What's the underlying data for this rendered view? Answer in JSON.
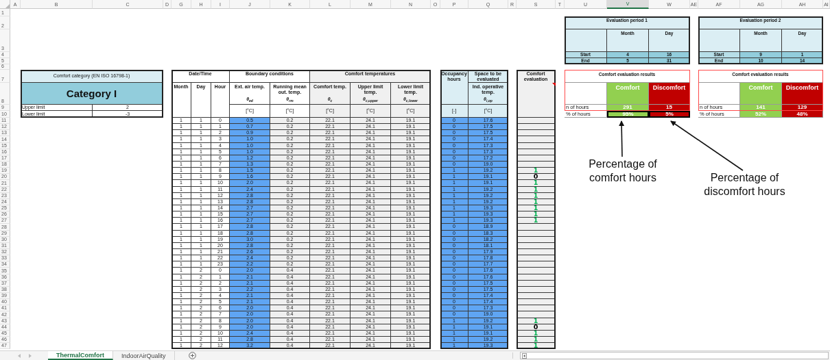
{
  "column_headers": [
    {
      "label": "A",
      "selected": false
    },
    {
      "label": "B",
      "selected": false
    },
    {
      "label": "C",
      "selected": false
    },
    {
      "label": "D",
      "selected": false
    },
    {
      "label": "G",
      "selected": false
    },
    {
      "label": "H",
      "selected": false
    },
    {
      "label": "I",
      "selected": false
    },
    {
      "label": "J",
      "selected": false
    },
    {
      "label": "K",
      "selected": false
    },
    {
      "label": "L",
      "selected": false
    },
    {
      "label": "M",
      "selected": false
    },
    {
      "label": "N",
      "selected": false
    },
    {
      "label": "O",
      "selected": false
    },
    {
      "label": "P",
      "selected": false
    },
    {
      "label": "Q",
      "selected": false
    },
    {
      "label": "R",
      "selected": false
    },
    {
      "label": "S",
      "selected": false
    },
    {
      "label": "T",
      "selected": false
    },
    {
      "label": "U",
      "selected": false
    },
    {
      "label": "V",
      "selected": true
    },
    {
      "label": "W",
      "selected": false
    },
    {
      "label": "AE",
      "selected": false
    },
    {
      "label": "AF",
      "selected": false
    },
    {
      "label": "AG",
      "selected": false
    },
    {
      "label": "AH",
      "selected": false
    },
    {
      "label": "AI",
      "selected": false
    }
  ],
  "row_headers": [
    "1",
    "2",
    "3",
    "4",
    "5",
    "6",
    "7",
    "8",
    "9",
    "10",
    "11",
    "12",
    "13",
    "14",
    "15",
    "16",
    "17",
    "18",
    "19",
    "20",
    "21",
    "22",
    "23",
    "24",
    "25",
    "26",
    "27",
    "28",
    "29",
    "30",
    "31",
    "32",
    "33",
    "34",
    "35",
    "36",
    "37",
    "38",
    "39",
    "40",
    "41",
    "42",
    "43",
    "44",
    "45",
    "46",
    "47"
  ],
  "comfort_category": {
    "title": "Comfort category (EN ISO 16798-1)",
    "category": "Category I",
    "limits": [
      {
        "label": "Upper limit",
        "value": "2"
      },
      {
        "label": "Lower limit",
        "value": "-3"
      }
    ]
  },
  "main_table": {
    "groups": [
      {
        "label": "Date/Time",
        "columns": [
          {
            "label": "Month"
          },
          {
            "label": "Day"
          },
          {
            "label": "Hour"
          }
        ]
      },
      {
        "label": "Boundary conditions",
        "columns": [
          {
            "label": "Ext. air temp.",
            "symbol": "θ$_{ed}$",
            "unit": "[°C]"
          },
          {
            "label": "Running mean out. temp.",
            "symbol": "θ$_{rm}$",
            "unit": "[°C]"
          }
        ]
      },
      {
        "label": "Comfort temperatures",
        "columns": [
          {
            "label": "Comfort temp.",
            "symbol": "θ$_{c}$",
            "unit": "[°C]"
          },
          {
            "label": "Upper limit temp.",
            "symbol": "θ$_{c,upper}$",
            "unit": "[°C]"
          },
          {
            "label": "Lower limit temp.",
            "symbol": "θ$_{c,lower}$",
            "unit": "[°C]"
          }
        ]
      }
    ]
  },
  "occupancy_table": {
    "columns": [
      {
        "label": "Occupancy hours",
        "unit": "[-]"
      },
      {
        "group": "Space to be evaluated",
        "label": "Ind. operative temp.",
        "symbol": "θ$_{i,op}$",
        "unit": "[°C]"
      }
    ]
  },
  "evaluation_column": {
    "label": "Comfort evaluation"
  },
  "rows": [
    {
      "cells": [
        "1",
        "1",
        "0",
        "0.5",
        "0.2",
        "22.1",
        "24.1",
        "19.1",
        "0",
        "17.6"
      ]
    },
    {
      "cells": [
        "1",
        "1",
        "1",
        "0.7",
        "0.2",
        "22.1",
        "24.1",
        "19.1",
        "0",
        "17.5"
      ]
    },
    {
      "cells": [
        "1",
        "1",
        "2",
        "0.9",
        "0.2",
        "22.1",
        "24.1",
        "19.1",
        "0",
        "17.5"
      ]
    },
    {
      "cells": [
        "1",
        "1",
        "3",
        "1.0",
        "0.2",
        "22.1",
        "24.1",
        "19.1",
        "0",
        "17.4"
      ]
    },
    {
      "cells": [
        "1",
        "1",
        "4",
        "1.0",
        "0.2",
        "22.1",
        "24.1",
        "19.1",
        "0",
        "17.3"
      ]
    },
    {
      "cells": [
        "1",
        "1",
        "5",
        "1.0",
        "0.2",
        "22.1",
        "24.1",
        "19.1",
        "0",
        "17.3"
      ]
    },
    {
      "cells": [
        "1",
        "1",
        "6",
        "1.2",
        "0.2",
        "22.1",
        "24.1",
        "19.1",
        "0",
        "17.2"
      ]
    },
    {
      "cells": [
        "1",
        "1",
        "7",
        "1.3",
        "0.2",
        "22.1",
        "24.1",
        "19.1",
        "0",
        "19.0"
      ]
    },
    {
      "cells": [
        "1",
        "1",
        "8",
        "1.5",
        "0.2",
        "22.1",
        "24.1",
        "19.1",
        "1",
        "19.2"
      ],
      "evaluation": {
        "text": "1",
        "color": "#00b050"
      }
    },
    {
      "cells": [
        "1",
        "1",
        "9",
        "1.6",
        "0.2",
        "22.1",
        "24.1",
        "19.1",
        "1",
        "19.1"
      ],
      "evaluation": {
        "text": "0",
        "color": "#000000"
      }
    },
    {
      "cells": [
        "1",
        "1",
        "10",
        "2.0",
        "0.2",
        "22.1",
        "24.1",
        "19.1",
        "1",
        "19.1"
      ],
      "evaluation": {
        "text": "1",
        "color": "#00b050"
      }
    },
    {
      "cells": [
        "1",
        "1",
        "11",
        "2.4",
        "0.2",
        "22.1",
        "24.1",
        "19.1",
        "1",
        "19.2"
      ],
      "evaluation": {
        "text": "1",
        "color": "#00b050"
      }
    },
    {
      "cells": [
        "1",
        "1",
        "12",
        "2.8",
        "0.2",
        "22.1",
        "24.1",
        "19.1",
        "1",
        "19.2"
      ],
      "evaluation": {
        "text": "1",
        "color": "#00b050"
      }
    },
    {
      "cells": [
        "1",
        "1",
        "13",
        "2.8",
        "0.2",
        "22.1",
        "24.1",
        "19.1",
        "1",
        "19.2"
      ],
      "evaluation": {
        "text": "1",
        "color": "#00b050"
      }
    },
    {
      "cells": [
        "1",
        "1",
        "14",
        "2.7",
        "0.2",
        "22.1",
        "24.1",
        "19.1",
        "1",
        "19.3"
      ],
      "evaluation": {
        "text": "1",
        "color": "#00b050"
      }
    },
    {
      "cells": [
        "1",
        "1",
        "15",
        "2.7",
        "0.2",
        "22.1",
        "24.1",
        "19.1",
        "1",
        "19.3"
      ],
      "evaluation": {
        "text": "1",
        "color": "#00b050"
      }
    },
    {
      "cells": [
        "1",
        "1",
        "16",
        "2.7",
        "0.2",
        "22.1",
        "24.1",
        "19.1",
        "1",
        "19.3"
      ],
      "evaluation": {
        "text": "1",
        "color": "#00b050"
      }
    },
    {
      "cells": [
        "1",
        "1",
        "17",
        "2.8",
        "0.2",
        "22.1",
        "24.1",
        "19.1",
        "0",
        "18.9"
      ]
    },
    {
      "cells": [
        "1",
        "1",
        "18",
        "2.8",
        "0.2",
        "22.1",
        "24.1",
        "19.1",
        "0",
        "18.3"
      ]
    },
    {
      "cells": [
        "1",
        "1",
        "19",
        "3.0",
        "0.2",
        "22.1",
        "24.1",
        "19.1",
        "0",
        "18.2"
      ]
    },
    {
      "cells": [
        "1",
        "1",
        "20",
        "2.8",
        "0.2",
        "22.1",
        "24.1",
        "19.1",
        "0",
        "18.1"
      ]
    },
    {
      "cells": [
        "1",
        "1",
        "21",
        "2.6",
        "0.2",
        "22.1",
        "24.1",
        "19.1",
        "0",
        "17.9"
      ]
    },
    {
      "cells": [
        "1",
        "1",
        "22",
        "2.4",
        "0.2",
        "22.1",
        "24.1",
        "19.1",
        "0",
        "17.8"
      ]
    },
    {
      "cells": [
        "1",
        "1",
        "23",
        "2.2",
        "0.2",
        "22.1",
        "24.1",
        "19.1",
        "0",
        "17.7"
      ]
    },
    {
      "cells": [
        "1",
        "2",
        "0",
        "2.0",
        "0.4",
        "22.1",
        "24.1",
        "19.1",
        "0",
        "17.6"
      ]
    },
    {
      "cells": [
        "1",
        "2",
        "1",
        "2.1",
        "0.4",
        "22.1",
        "24.1",
        "19.1",
        "0",
        "17.6"
      ]
    },
    {
      "cells": [
        "1",
        "2",
        "2",
        "2.1",
        "0.4",
        "22.1",
        "24.1",
        "19.1",
        "0",
        "17.5"
      ]
    },
    {
      "cells": [
        "1",
        "2",
        "3",
        "2.2",
        "0.4",
        "22.1",
        "24.1",
        "19.1",
        "0",
        "17.5"
      ]
    },
    {
      "cells": [
        "1",
        "2",
        "4",
        "2.1",
        "0.4",
        "22.1",
        "24.1",
        "19.1",
        "0",
        "17.4"
      ]
    },
    {
      "cells": [
        "1",
        "2",
        "5",
        "2.1",
        "0.4",
        "22.1",
        "24.1",
        "19.1",
        "0",
        "17.4"
      ]
    },
    {
      "cells": [
        "1",
        "2",
        "6",
        "2.0",
        "0.4",
        "22.1",
        "24.1",
        "19.1",
        "0",
        "17.3"
      ]
    },
    {
      "cells": [
        "1",
        "2",
        "7",
        "2.0",
        "0.4",
        "22.1",
        "24.1",
        "19.1",
        "0",
        "19.0"
      ]
    },
    {
      "cells": [
        "1",
        "2",
        "8",
        "2.0",
        "0.4",
        "22.1",
        "24.1",
        "19.1",
        "1",
        "19.2"
      ],
      "evaluation": {
        "text": "1",
        "color": "#00b050"
      }
    },
    {
      "cells": [
        "1",
        "2",
        "9",
        "2.0",
        "0.4",
        "22.1",
        "24.1",
        "19.1",
        "1",
        "19.1"
      ],
      "evaluation": {
        "text": "0",
        "color": "#000000"
      }
    },
    {
      "cells": [
        "1",
        "2",
        "10",
        "2.4",
        "0.4",
        "22.1",
        "24.1",
        "19.1",
        "1",
        "19.1"
      ],
      "evaluation": {
        "text": "1",
        "color": "#00b050"
      }
    },
    {
      "cells": [
        "1",
        "2",
        "11",
        "2.8",
        "0.4",
        "22.1",
        "24.1",
        "19.1",
        "1",
        "19.2"
      ],
      "evaluation": {
        "text": "1",
        "color": "#00b050"
      }
    },
    {
      "cells": [
        "1",
        "2",
        "12",
        "3.2",
        "0.4",
        "22.1",
        "24.1",
        "19.1",
        "1",
        "19.3"
      ],
      "evaluation": {
        "text": "1",
        "color": "#00b050"
      }
    }
  ],
  "evaluation_periods": [
    {
      "title": "Evaluation period 1",
      "headers": [
        "Month",
        "Day"
      ],
      "rows": [
        {
          "label": "Start",
          "values": [
            "4",
            "16"
          ]
        },
        {
          "label": "End",
          "values": [
            "5",
            "31"
          ]
        }
      ],
      "results": {
        "title": "Comfort evaluation results",
        "headers": [
          {
            "label": "Comfort",
            "color": "#92d050"
          },
          {
            "label": "Discomfort",
            "color": "#c00000"
          }
        ],
        "rows": [
          {
            "label": "n of hours",
            "values": [
              "291",
              "15"
            ],
            "outlined": false
          },
          {
            "label": "% of hours",
            "values": [
              "95%",
              "5%"
            ],
            "outlined": true
          }
        ]
      }
    },
    {
      "title": "Evaluation period 2",
      "headers": [
        "Month",
        "Day"
      ],
      "rows": [
        {
          "label": "Start",
          "values": [
            "9",
            "1"
          ]
        },
        {
          "label": "End",
          "values": [
            "10",
            "14"
          ]
        }
      ],
      "results": {
        "title": "Comfort evaluation results",
        "headers": [
          {
            "label": "Comfort",
            "color": "#92d050"
          },
          {
            "label": "Discomfort",
            "color": "#c00000"
          }
        ],
        "rows": [
          {
            "label": "n of hours",
            "values": [
              "141",
              "129"
            ],
            "outlined": false
          },
          {
            "label": "% of hours",
            "values": [
              "52%",
              "48%"
            ],
            "outlined": false
          }
        ]
      }
    }
  ],
  "annotations": [
    {
      "text": "Percentage of comfort hours"
    },
    {
      "text": "Percentage of discomfort hours"
    }
  ],
  "sheet_tabs": [
    {
      "label": "ThermalComfort",
      "selected": true
    },
    {
      "label": "IndoorAirQuality",
      "selected": false
    }
  ]
}
